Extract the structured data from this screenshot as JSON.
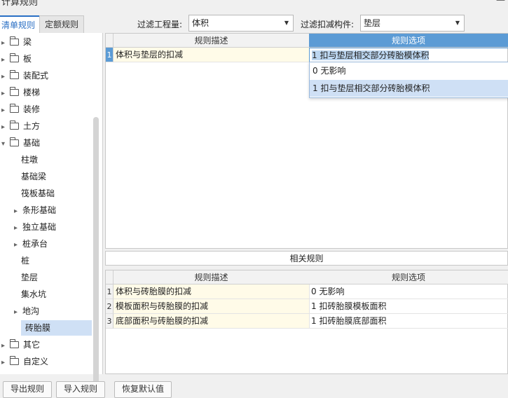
{
  "window": {
    "title": "计算规则",
    "close_icon": "close-icon"
  },
  "tabs": [
    "清单规则",
    "定额规则"
  ],
  "filters": {
    "quantity_label": "过滤工程量:",
    "quantity_value": "体积",
    "member_label": "过滤扣减构件:",
    "member_value": "垫层"
  },
  "tree": {
    "items": [
      {
        "label": "梁",
        "type": "folder",
        "expanded": false
      },
      {
        "label": "板",
        "type": "folder",
        "expanded": false
      },
      {
        "label": "装配式",
        "type": "folder",
        "expanded": false
      },
      {
        "label": "楼梯",
        "type": "folder",
        "expanded": false
      },
      {
        "label": "装修",
        "type": "folder",
        "expanded": false
      },
      {
        "label": "土方",
        "type": "folder",
        "expanded": false
      },
      {
        "label": "基础",
        "type": "folder",
        "expanded": true
      },
      {
        "label": "柱墩",
        "type": "leaf"
      },
      {
        "label": "基础梁",
        "type": "leaf"
      },
      {
        "label": "筏板基础",
        "type": "leaf"
      },
      {
        "label": "条形基础",
        "type": "group"
      },
      {
        "label": "独立基础",
        "type": "group"
      },
      {
        "label": "桩承台",
        "type": "group"
      },
      {
        "label": "桩",
        "type": "leaf"
      },
      {
        "label": "垫层",
        "type": "leaf"
      },
      {
        "label": "集水坑",
        "type": "leaf"
      },
      {
        "label": "地沟",
        "type": "group"
      },
      {
        "label": "砖胎膜",
        "type": "leaf",
        "selected": true
      },
      {
        "label": "其它",
        "type": "folder",
        "expanded": false
      },
      {
        "label": "自定义",
        "type": "folder",
        "expanded": false
      }
    ]
  },
  "top_grid": {
    "headers": [
      "规则描述",
      "规则选项"
    ],
    "rows": [
      {
        "num": "1",
        "desc": "体积与垫层的扣减",
        "option": "1 扣与垫层相交部分砖胎模体积"
      }
    ],
    "dropdown": [
      "0  无影响",
      "1 扣与垫层相交部分砖胎模体积"
    ]
  },
  "related": {
    "title": "相关规则",
    "headers": [
      "规则描述",
      "规则选项"
    ],
    "rows": [
      {
        "num": "1",
        "desc": "体积与砖胎膜的扣减",
        "option": "0   无影响"
      },
      {
        "num": "2",
        "desc": "模板面积与砖胎膜的扣减",
        "option": "1 扣砖胎膜模板面积"
      },
      {
        "num": "3",
        "desc": "底部面积与砖胎膜的扣减",
        "option": "1 扣砖胎膜底部面积"
      }
    ]
  },
  "buttons": [
    "导出规则",
    "导入规则",
    "恢复默认值"
  ],
  "colors": {
    "accent": "#5b9bd5",
    "selection": "#cfe0f5",
    "cell_highlight": "#fffbe8"
  }
}
